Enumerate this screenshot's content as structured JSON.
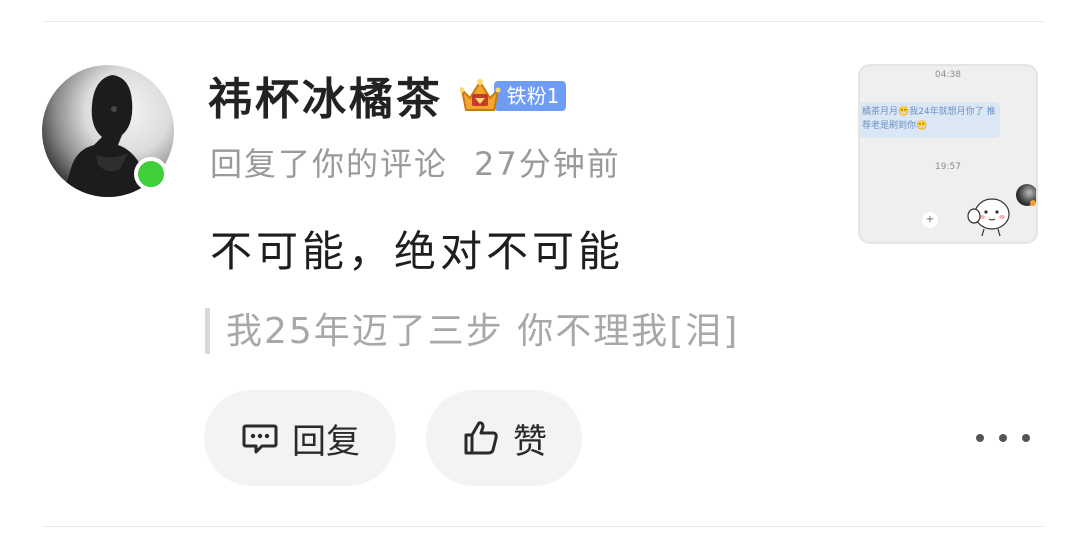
{
  "comment": {
    "username": "祎杯冰橘茶",
    "fan_badge": "铁粉1",
    "action": "回复了你的评论",
    "time": "27分钟前",
    "text": "不可能，绝对不可能",
    "quoted": "我25年迈了三步 你不理我[泪]",
    "online": true
  },
  "buttons": {
    "reply": "回复",
    "like": "赞"
  },
  "thumbnail": {
    "time_top": "04:38",
    "message": "橘茶月月😬我24年就想月你了 推荐老是刷到你😬",
    "time_mid": "19:57"
  },
  "colors": {
    "online_dot": "#3fcf3b",
    "fan_badge_bg": "#6f9cf5",
    "button_bg": "#f3f3f3"
  },
  "icons": {
    "reply": "comment-bubble-icon",
    "like": "thumbs-up-icon",
    "more": "more-dots-icon",
    "badge": "crown-icon"
  }
}
